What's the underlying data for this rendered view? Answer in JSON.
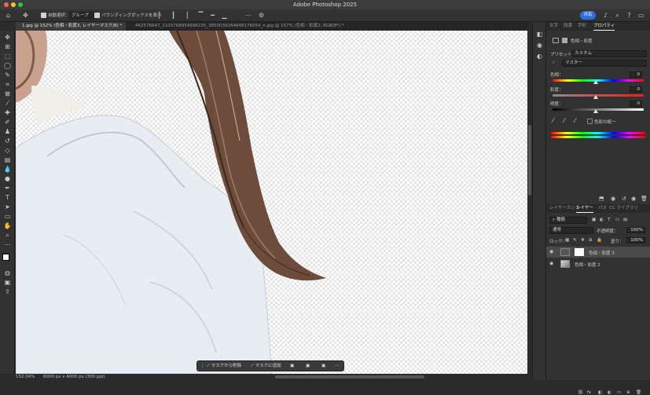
{
  "app_title": "Adobe Photoshop 2025",
  "options_bar": {
    "auto_select_label": "自動選択：",
    "auto_select_target": "グループ",
    "show_bounding_box_label": "バウンディングボックスを表示",
    "share_label": "共有"
  },
  "doc_tabs": [
    {
      "label": "1.jpg @ 152% (色相・彩度3, レイヤーマスク/8) *",
      "active": true
    },
    {
      "label": "462576647_1103768954698225_3850039164848176054_n.jpg @ 157% (色相・彩度2, RGB/8*) *",
      "active": false
    }
  ],
  "status_bar": {
    "zoom": "152.04%",
    "doc_info": "6000 px x 4000 px (300 ppi)"
  },
  "taskbar": {
    "subtract_mask": "マスクから削除",
    "add_mask": "マスクに追加"
  },
  "properties_panel": {
    "tabs": [
      "文字",
      "段落",
      "字形",
      "プロパティ"
    ],
    "active_tab": "プロパティ",
    "adjustment_title": "色相・彩度",
    "preset_label": "プリセット：",
    "preset_value": "カスタム",
    "channel_value": "マスター",
    "hue_label": "色相：",
    "hue_value": "0",
    "saturation_label": "彩度：",
    "saturation_value": "0",
    "lightness_label": "明度：",
    "lightness_value": "0",
    "colorize_label": "色彩の統一"
  },
  "layers_panel": {
    "tabs": [
      "レイヤーカンプ",
      "レイヤー",
      "パス",
      "CC ライブラリ"
    ],
    "active_tab": "レイヤー",
    "filter_kind": "種類",
    "blend_mode": "通常",
    "opacity_label": "不透明度：",
    "opacity_value": "100%",
    "lock_label": "ロック：",
    "fill_label": "塗り：",
    "fill_value": "100%",
    "layers": [
      {
        "name": "色相・彩度 3",
        "selected": true
      },
      {
        "name": "色相・彩度 2",
        "selected": false
      }
    ]
  },
  "colors": {
    "accent_blue": "#2e6ddb",
    "panel_bg": "#323232",
    "canvas_hoodie": "#e8ecf3"
  }
}
